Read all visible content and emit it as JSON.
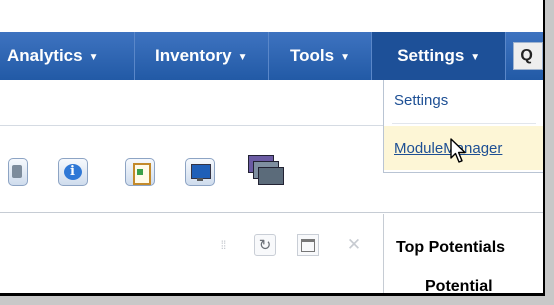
{
  "navbar": {
    "items": [
      {
        "label": "Analytics"
      },
      {
        "label": "Inventory"
      },
      {
        "label": "Tools"
      },
      {
        "label": "Settings"
      }
    ],
    "caret": "▼",
    "search_fragment": "Q"
  },
  "settings_menu": {
    "items": [
      {
        "label": "Settings"
      },
      {
        "label": "ModuleManager"
      }
    ]
  },
  "panel": {
    "title": "Top Potentials",
    "column_header": "Potential"
  },
  "colors": {
    "nav_bg": "#2d64b1",
    "nav_active": "#1d5098",
    "link": "#1d4f94",
    "hover": "#fdf6d6"
  },
  "icons": [
    "phone-icon",
    "info-icon",
    "clipboard-icon",
    "monitor-icon",
    "documents-stack-icon",
    "split-icon",
    "refresh-icon",
    "layout-icon",
    "close-icon",
    "pointer-cursor-icon"
  ]
}
